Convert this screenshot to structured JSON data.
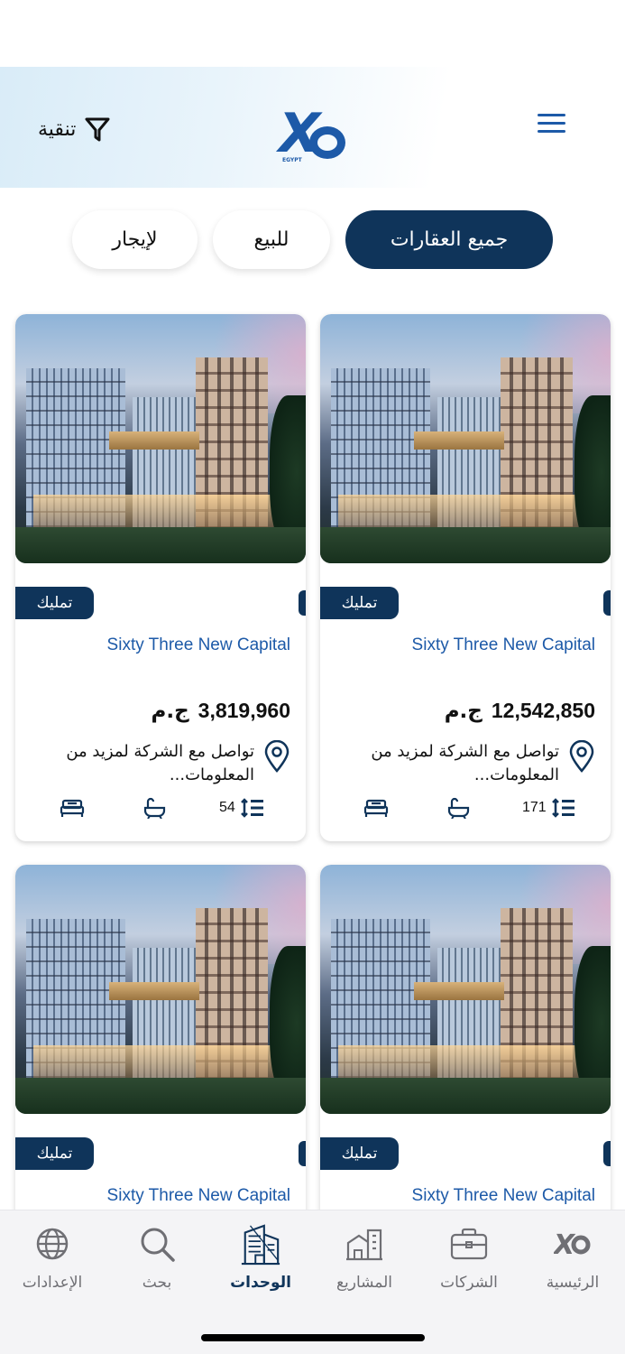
{
  "header": {
    "logo_text": "Xo",
    "logo_sub": "EGYPT",
    "filter_label": "تنقية"
  },
  "tabs": [
    {
      "label": "جميع العقارات",
      "active": true
    },
    {
      "label": "للبيع",
      "active": false
    },
    {
      "label": "لإيجار",
      "active": false
    }
  ],
  "cards": [
    {
      "badge": "تمليك",
      "title": "Sixty Three New Capital",
      "price": "12,542,850",
      "currency": "ج.م",
      "location_text": "تواصل مع الشركة لمزيد من المعلومات...",
      "area": "171"
    },
    {
      "badge": "تمليك",
      "title": "Sixty Three New Capital",
      "price": "3,819,960",
      "currency": "ج.م",
      "location_text": "تواصل مع الشركة لمزيد من المعلومات...",
      "area": "54"
    },
    {
      "badge": "تمليك",
      "title": "Sixty Three New Capital"
    },
    {
      "badge": "تمليك",
      "title": "Sixty Three New Capital"
    }
  ],
  "nav": [
    {
      "label": "الرئيسية",
      "icon": "xo-logo-icon"
    },
    {
      "label": "الشركات",
      "icon": "briefcase-icon"
    },
    {
      "label": "المشاريع",
      "icon": "buildings-icon"
    },
    {
      "label": "الوحدات",
      "icon": "units-icon",
      "active": true
    },
    {
      "label": "بحث",
      "icon": "search-icon"
    },
    {
      "label": "الإعدادات",
      "icon": "globe-icon"
    }
  ],
  "colors": {
    "primary": "#0f345a",
    "accent": "#1d5aa8",
    "nav_inactive": "#6f6f74"
  }
}
